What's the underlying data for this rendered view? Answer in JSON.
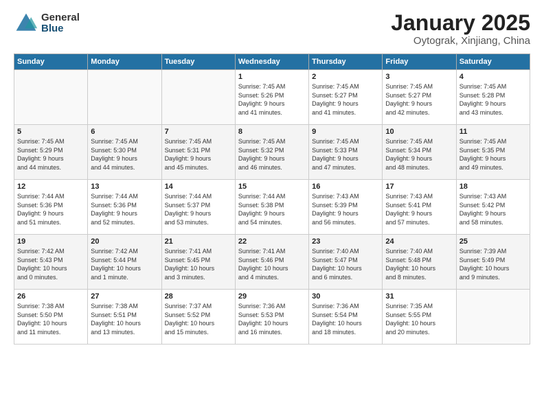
{
  "logo": {
    "general": "General",
    "blue": "Blue"
  },
  "header": {
    "title": "January 2025",
    "subtitle": "Oytograk, Xinjiang, China"
  },
  "weekdays": [
    "Sunday",
    "Monday",
    "Tuesday",
    "Wednesday",
    "Thursday",
    "Friday",
    "Saturday"
  ],
  "weeks": [
    [
      {
        "day": "",
        "info": ""
      },
      {
        "day": "",
        "info": ""
      },
      {
        "day": "",
        "info": ""
      },
      {
        "day": "1",
        "info": "Sunrise: 7:45 AM\nSunset: 5:26 PM\nDaylight: 9 hours\nand 41 minutes."
      },
      {
        "day": "2",
        "info": "Sunrise: 7:45 AM\nSunset: 5:27 PM\nDaylight: 9 hours\nand 41 minutes."
      },
      {
        "day": "3",
        "info": "Sunrise: 7:45 AM\nSunset: 5:27 PM\nDaylight: 9 hours\nand 42 minutes."
      },
      {
        "day": "4",
        "info": "Sunrise: 7:45 AM\nSunset: 5:28 PM\nDaylight: 9 hours\nand 43 minutes."
      }
    ],
    [
      {
        "day": "5",
        "info": "Sunrise: 7:45 AM\nSunset: 5:29 PM\nDaylight: 9 hours\nand 44 minutes."
      },
      {
        "day": "6",
        "info": "Sunrise: 7:45 AM\nSunset: 5:30 PM\nDaylight: 9 hours\nand 44 minutes."
      },
      {
        "day": "7",
        "info": "Sunrise: 7:45 AM\nSunset: 5:31 PM\nDaylight: 9 hours\nand 45 minutes."
      },
      {
        "day": "8",
        "info": "Sunrise: 7:45 AM\nSunset: 5:32 PM\nDaylight: 9 hours\nand 46 minutes."
      },
      {
        "day": "9",
        "info": "Sunrise: 7:45 AM\nSunset: 5:33 PM\nDaylight: 9 hours\nand 47 minutes."
      },
      {
        "day": "10",
        "info": "Sunrise: 7:45 AM\nSunset: 5:34 PM\nDaylight: 9 hours\nand 48 minutes."
      },
      {
        "day": "11",
        "info": "Sunrise: 7:45 AM\nSunset: 5:35 PM\nDaylight: 9 hours\nand 49 minutes."
      }
    ],
    [
      {
        "day": "12",
        "info": "Sunrise: 7:44 AM\nSunset: 5:36 PM\nDaylight: 9 hours\nand 51 minutes."
      },
      {
        "day": "13",
        "info": "Sunrise: 7:44 AM\nSunset: 5:36 PM\nDaylight: 9 hours\nand 52 minutes."
      },
      {
        "day": "14",
        "info": "Sunrise: 7:44 AM\nSunset: 5:37 PM\nDaylight: 9 hours\nand 53 minutes."
      },
      {
        "day": "15",
        "info": "Sunrise: 7:44 AM\nSunset: 5:38 PM\nDaylight: 9 hours\nand 54 minutes."
      },
      {
        "day": "16",
        "info": "Sunrise: 7:43 AM\nSunset: 5:39 PM\nDaylight: 9 hours\nand 56 minutes."
      },
      {
        "day": "17",
        "info": "Sunrise: 7:43 AM\nSunset: 5:41 PM\nDaylight: 9 hours\nand 57 minutes."
      },
      {
        "day": "18",
        "info": "Sunrise: 7:43 AM\nSunset: 5:42 PM\nDaylight: 9 hours\nand 58 minutes."
      }
    ],
    [
      {
        "day": "19",
        "info": "Sunrise: 7:42 AM\nSunset: 5:43 PM\nDaylight: 10 hours\nand 0 minutes."
      },
      {
        "day": "20",
        "info": "Sunrise: 7:42 AM\nSunset: 5:44 PM\nDaylight: 10 hours\nand 1 minute."
      },
      {
        "day": "21",
        "info": "Sunrise: 7:41 AM\nSunset: 5:45 PM\nDaylight: 10 hours\nand 3 minutes."
      },
      {
        "day": "22",
        "info": "Sunrise: 7:41 AM\nSunset: 5:46 PM\nDaylight: 10 hours\nand 4 minutes."
      },
      {
        "day": "23",
        "info": "Sunrise: 7:40 AM\nSunset: 5:47 PM\nDaylight: 10 hours\nand 6 minutes."
      },
      {
        "day": "24",
        "info": "Sunrise: 7:40 AM\nSunset: 5:48 PM\nDaylight: 10 hours\nand 8 minutes."
      },
      {
        "day": "25",
        "info": "Sunrise: 7:39 AM\nSunset: 5:49 PM\nDaylight: 10 hours\nand 9 minutes."
      }
    ],
    [
      {
        "day": "26",
        "info": "Sunrise: 7:38 AM\nSunset: 5:50 PM\nDaylight: 10 hours\nand 11 minutes."
      },
      {
        "day": "27",
        "info": "Sunrise: 7:38 AM\nSunset: 5:51 PM\nDaylight: 10 hours\nand 13 minutes."
      },
      {
        "day": "28",
        "info": "Sunrise: 7:37 AM\nSunset: 5:52 PM\nDaylight: 10 hours\nand 15 minutes."
      },
      {
        "day": "29",
        "info": "Sunrise: 7:36 AM\nSunset: 5:53 PM\nDaylight: 10 hours\nand 16 minutes."
      },
      {
        "day": "30",
        "info": "Sunrise: 7:36 AM\nSunset: 5:54 PM\nDaylight: 10 hours\nand 18 minutes."
      },
      {
        "day": "31",
        "info": "Sunrise: 7:35 AM\nSunset: 5:55 PM\nDaylight: 10 hours\nand 20 minutes."
      },
      {
        "day": "",
        "info": ""
      }
    ]
  ]
}
